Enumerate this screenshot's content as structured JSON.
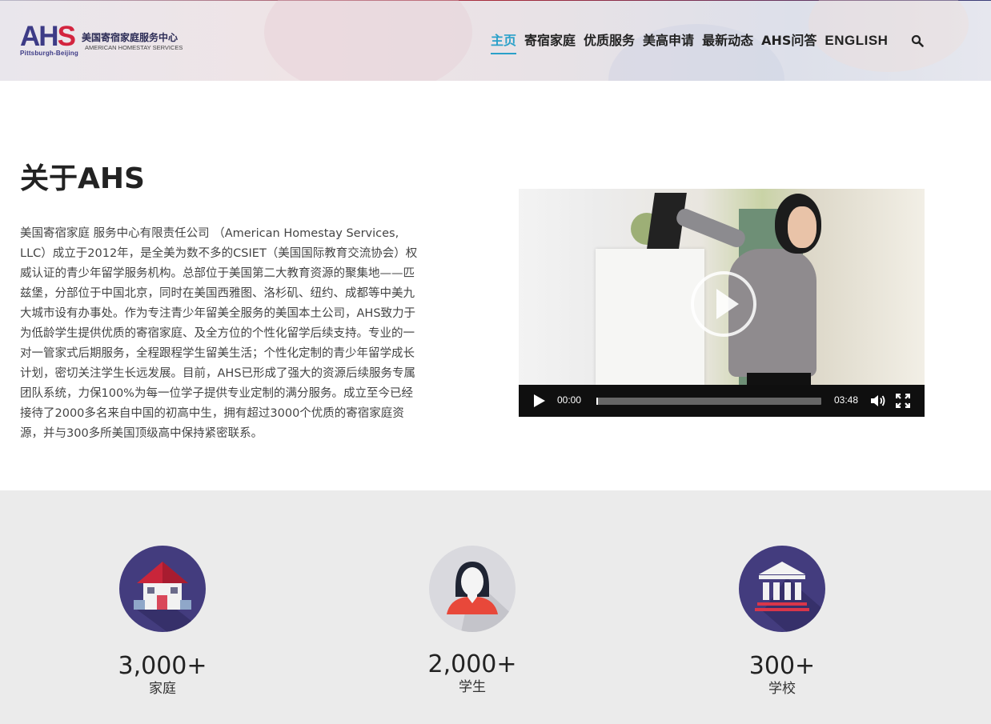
{
  "header": {
    "logo": {
      "mark_a": "AH",
      "mark_s": "S",
      "sub": "Pittsburgh-Beijing",
      "name_cn": "美国寄宿家庭服务中心",
      "name_en": "AMERICAN HOMESTAY SERVICES"
    },
    "nav": [
      {
        "label": "主页",
        "active": true
      },
      {
        "label": "寄宿家庭",
        "active": false
      },
      {
        "label": "优质服务",
        "active": false
      },
      {
        "label": "美高申请",
        "active": false
      },
      {
        "label": "最新动态",
        "active": false
      },
      {
        "label": "AHS问答",
        "active": false
      },
      {
        "label": "ENGLISH",
        "active": false
      }
    ],
    "search_icon": "search-icon"
  },
  "about": {
    "title": "关于AHS",
    "text": "美国寄宿家庭 服务中心有限责任公司 （American Homestay Services, LLC）成立于2012年，是全美为数不多的CSIET（美国国际教育交流协会）权威认证的青少年留学服务机构。总部位于美国第二大教育资源的聚集地——匹兹堡，分部位于中国北京，同时在美国西雅图、洛杉矶、纽约、成都等中美九大城市设有办事处。作为专注青少年留美全服务的美国本土公司，AHS致力于为低龄学生提供优质的寄宿家庭、及全方位的个性化留学后续支持。专业的一对一管家式后期服务，全程跟程学生留美生活；个性化定制的青少年留学成长计划，密切关注学生长远发展。目前，AHS已形成了强大的资源后续服务专属团队系统，力保100%为每一位学子提供专业定制的满分服务。成立至今已经接待了2000多名来自中国的初高中生，拥有超过3000个优质的寄宿家庭资源，并与300多所美国顶级高中保持紧密联系。"
  },
  "video": {
    "current_time": "00:00",
    "duration": "03:48",
    "progress": 0
  },
  "stats": [
    {
      "number": "3,000+",
      "label": "家庭",
      "icon": "house-icon",
      "color": "#433c7e"
    },
    {
      "number": "2,000+",
      "label": "学生",
      "icon": "student-icon",
      "color": "#d9d9de"
    },
    {
      "number": "300+",
      "label": "学校",
      "icon": "school-building-icon",
      "color": "#433c7e"
    }
  ],
  "colors": {
    "accent": "#2aa0c9",
    "brand_blue": "#3d3b86",
    "brand_red": "#d3253f",
    "stats_bg": "#ebebeb"
  }
}
